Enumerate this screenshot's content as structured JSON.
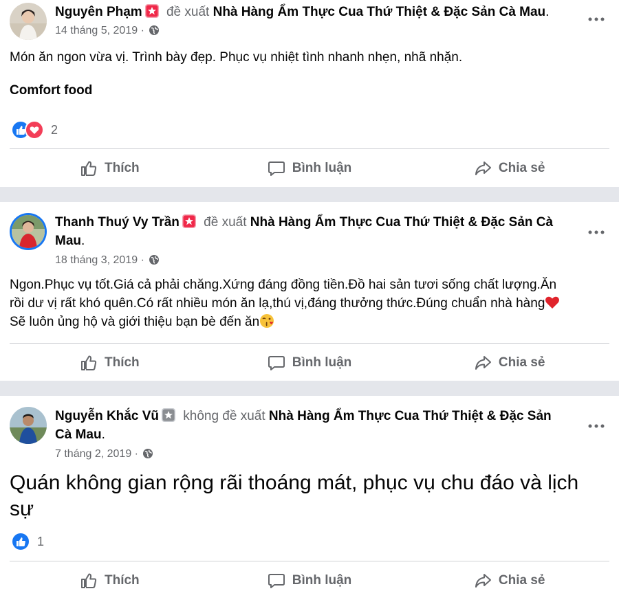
{
  "colors": {
    "accent": "#1877f2",
    "secondary_text": "#65676b",
    "love": "#f33e58",
    "badge": "#f02849"
  },
  "action_labels": {
    "like": "Thích",
    "comment": "Bình luận",
    "share": "Chia sẻ"
  },
  "posts": [
    {
      "author": "Nguyên Phạm",
      "verb": "đề xuất",
      "page": "Nhà Hàng Ẩm Thực Cua Thứ Thiệt & Đặc Sản Cà Mau",
      "end": ".",
      "date": "14 tháng 5, 2019",
      "sep": "·",
      "text_lines": [
        "Món ăn ngon vừa vị. Trình bày đẹp. Phục vụ nhiệt tình nhanh nhẹn, nhã nhặn."
      ],
      "tag": "Comfort food",
      "reactions": [
        "like-icon",
        "love-icon"
      ],
      "reaction_count": "2"
    },
    {
      "author": "Thanh Thuý Vy Trần",
      "verb": "đề xuất",
      "page": "Nhà Hàng Ẩm Thực Cua Thứ Thiệt & Đặc Sản Cà Mau",
      "end": ".",
      "date": "18 tháng 3, 2019",
      "sep": "·",
      "text_lines": [
        "Ngon.Phục vụ tốt.Giá cả phải chăng.Xứng đáng đồng tiền.Đồ hai sản tươi sống chất lượng.Ăn",
        "rồi dư vị rất khó quên.Có rất nhiều món ăn lạ,thú vị,đáng thưởng thức.Đúng chuẩn nhà hàng",
        "Sẽ luôn ủng hộ và giới thiệu bạn bè đến ăn"
      ],
      "emojis": [
        "red-heart-emoji",
        "kissing-face-emoji"
      ]
    },
    {
      "author": "Nguyễn Khắc Vũ",
      "verb": "không đề xuất",
      "page": "Nhà Hàng Ẩm Thực Cua Thứ Thiệt & Đặc Sản Cà Mau",
      "end": ".",
      "date": "7 tháng 2, 2019",
      "sep": "·",
      "text_lines": [
        "Quán không gian rộng rãi thoáng mát, phục vụ chu đáo và lịch",
        "sự"
      ],
      "reactions": [
        "like-icon"
      ],
      "reaction_count": "1"
    }
  ]
}
